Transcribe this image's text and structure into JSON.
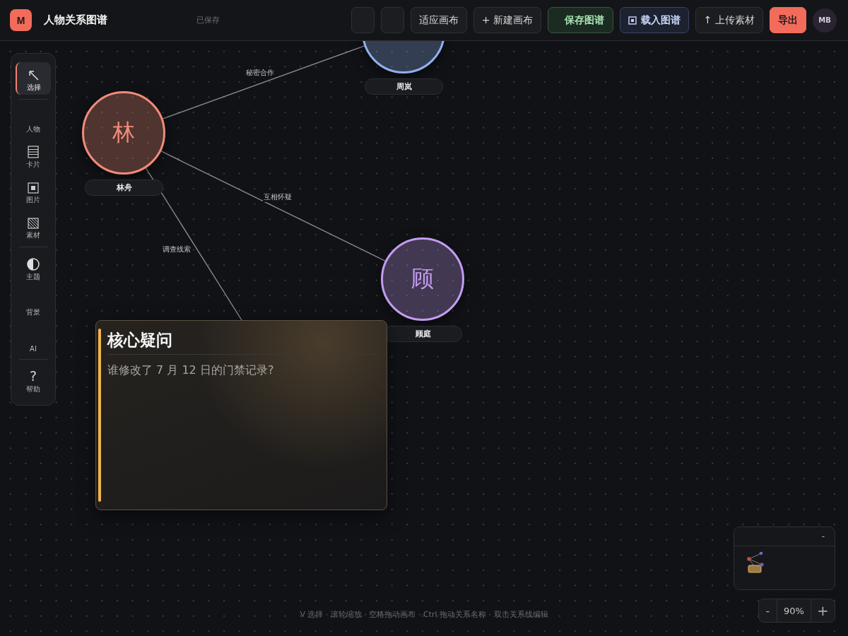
{
  "app": {
    "logo": "M",
    "title": "人物关系图谱",
    "status": "已保存"
  },
  "toolbar": [
    {
      "kind": "blank"
    },
    {
      "kind": "blank"
    },
    {
      "kind": "plain",
      "label": "适应画布"
    },
    {
      "kind": "plain",
      "label": "+ 新建画布"
    },
    {
      "kind": "save",
      "label": "保存图谱"
    },
    {
      "kind": "load",
      "label": "载入图谱"
    },
    {
      "kind": "plain",
      "label": "↑ 上传素材"
    },
    {
      "kind": "export",
      "label": "导出"
    }
  ],
  "user": {
    "initials": "MB"
  },
  "sidebar": [
    [
      {
        "label": "选择",
        "kind": "cursor",
        "selected": true
      }
    ],
    [
      {
        "label": "人物",
        "kind": "plain",
        "selected": false
      },
      {
        "label": "卡片",
        "kind": "card",
        "selected": false
      },
      {
        "label": "图片",
        "kind": "image",
        "selected": false
      },
      {
        "label": "素材",
        "kind": "hatch",
        "selected": false
      }
    ],
    [
      {
        "label": "主题",
        "kind": "contrast",
        "selected": false
      },
      {
        "label": "背景",
        "kind": "plain",
        "selected": false
      },
      {
        "label": "AI",
        "kind": "plain",
        "selected": false
      }
    ],
    [
      {
        "label": "帮助",
        "glyph": "?",
        "selected": false
      }
    ]
  ],
  "nodes": [
    {
      "char": "林",
      "name": "林舟",
      "color": "#f28b78"
    },
    {
      "name": "周岚",
      "color": "#8fb0f0"
    },
    {
      "char": "顾",
      "name": "顾庭",
      "color": "#c39cf0"
    }
  ],
  "card": {
    "title": "核心疑问",
    "body": "谁修改了 7 月 12 日的门禁记录?"
  },
  "edges": [
    {
      "label": "秘密合作"
    },
    {
      "label": "互相怀疑"
    },
    {
      "label": "调查线索"
    }
  ],
  "minimap": {
    "collapse": "-"
  },
  "zoom": {
    "minus": "-",
    "value": "90%",
    "plus": "+"
  },
  "hint": "V 选择 · 滚轮缩放 · 空格拖动画布 · Ctrl 拖动关系名称 · 双击关系线编辑"
}
